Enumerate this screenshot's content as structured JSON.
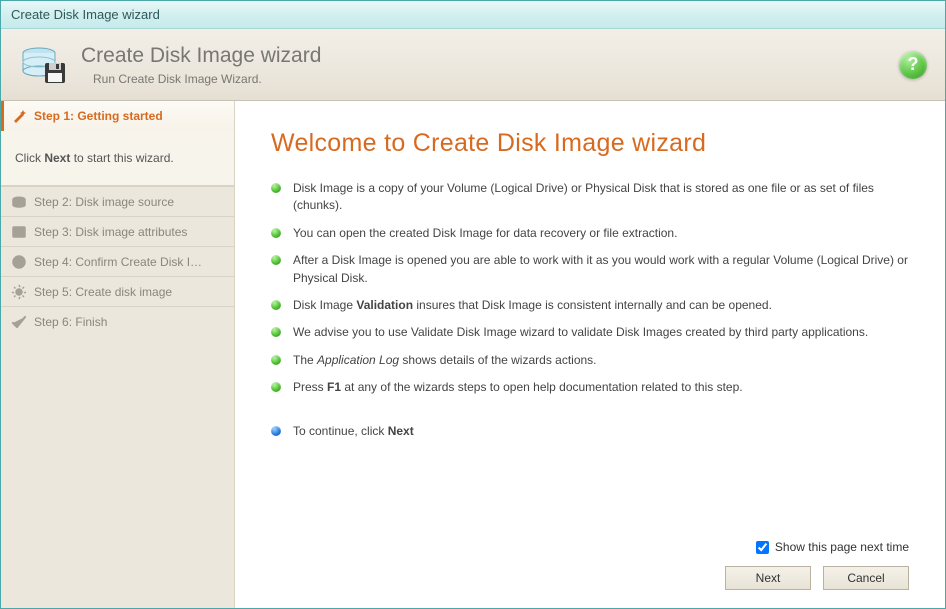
{
  "title": "Create Disk Image wizard",
  "header": {
    "title": "Create Disk Image wizard",
    "subtitle": "Run Create Disk Image Wizard."
  },
  "instruction_html": "Click <b>Next</b> to start this wizard.",
  "steps": [
    {
      "label": "Step 1: Getting started",
      "active": true,
      "icon": "wand"
    },
    {
      "label": "Step 2: Disk image source",
      "active": false,
      "icon": "disks"
    },
    {
      "label": "Step 3: Disk image attributes",
      "active": false,
      "icon": "props"
    },
    {
      "label": "Step 4: Confirm Create Disk I…",
      "active": false,
      "icon": "info"
    },
    {
      "label": "Step 5: Create disk image",
      "active": false,
      "icon": "gear"
    },
    {
      "label": "Step 6: Finish",
      "active": false,
      "icon": "check"
    }
  ],
  "welcome_title": "Welcome to Create Disk Image wizard",
  "bullets": [
    {
      "html": "Disk Image is a copy of your Volume (Logical Drive) or Physical Disk that is stored as one file or as set of files (chunks)."
    },
    {
      "html": "You can open the created Disk Image for data recovery or file extraction."
    },
    {
      "html": "After a Disk Image is opened you are able to work with it as you would work with a regular Volume (Logical Drive) or Physical Disk."
    },
    {
      "html": "Disk Image <b>Validation</b> insures that Disk Image is consistent internally and can be opened."
    },
    {
      "html": "We advise you to use Validate Disk Image wizard to validate Disk Images created by third party applications."
    },
    {
      "html": "The <i>Application Log</i> shows details of the wizards actions."
    },
    {
      "html": "Press <b>F1</b> at any of the wizards steps to open help documentation related to this step."
    }
  ],
  "continue_html": "To continue, click <b>Next</b>",
  "show_next_time_label": "Show this page next time",
  "show_next_time_checked": true,
  "buttons": {
    "next": "Next",
    "cancel": "Cancel"
  }
}
